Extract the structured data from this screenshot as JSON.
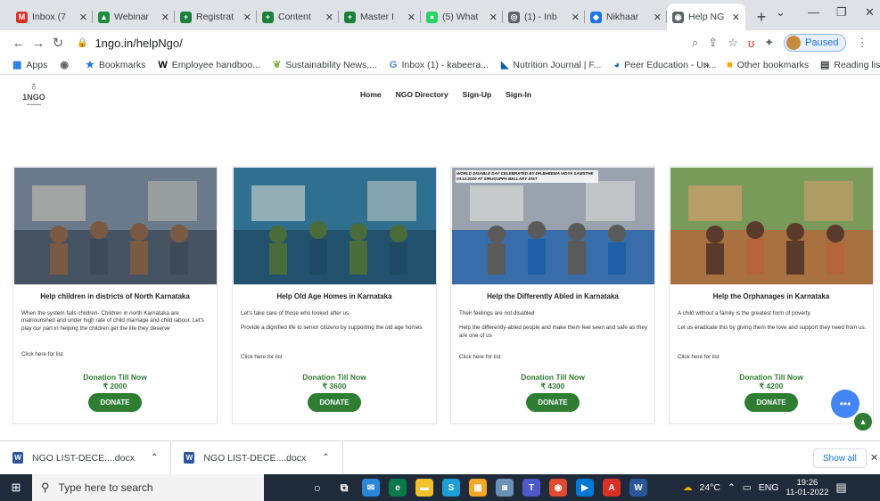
{
  "browser": {
    "tabs": [
      {
        "title": "Inbox (7",
        "icon": "gmail-icon",
        "color": "#d93025",
        "glyph": "M"
      },
      {
        "title": "Webinar",
        "icon": "drive-icon",
        "color": "#1e8e3e",
        "glyph": "▲"
      },
      {
        "title": "Registrat",
        "icon": "plus-doc-icon",
        "color": "#188038",
        "glyph": "+"
      },
      {
        "title": "Content",
        "icon": "plus-doc-icon",
        "color": "#188038",
        "glyph": "+"
      },
      {
        "title": "Master I",
        "icon": "plus-doc-icon",
        "color": "#188038",
        "glyph": "+"
      },
      {
        "title": "(5) What",
        "icon": "whatsapp-icon",
        "color": "#25d366",
        "glyph": "●"
      },
      {
        "title": "(1) - Inb",
        "icon": "mail-icon",
        "color": "#5f6368",
        "glyph": "◎"
      },
      {
        "title": "Nikhaar",
        "icon": "nikhaar-icon",
        "color": "#1a73e8",
        "glyph": "◆"
      },
      {
        "title": "Help NG",
        "icon": "globe-icon",
        "color": "#5f6368",
        "glyph": "◉",
        "active": true
      }
    ],
    "url": "1ngo.in/helpNgo/",
    "profile_status": "Paused",
    "bookmarks": [
      {
        "label": "Apps",
        "icon": "apps-grid-icon",
        "glyph": "▦",
        "color": "#1a73e8"
      },
      {
        "label": "",
        "icon": "globe-icon",
        "glyph": "◉",
        "color": "#5f6368"
      },
      {
        "label": "Bookmarks",
        "icon": "star-icon",
        "glyph": "★",
        "color": "#1a73e8"
      },
      {
        "label": "Employee handboo...",
        "icon": "wikipedia-icon",
        "glyph": "W",
        "color": "#000000"
      },
      {
        "label": "Sustainability News,...",
        "icon": "leaf-icon",
        "glyph": "❦",
        "color": "#7cb342"
      },
      {
        "label": "Inbox (1) - kabeera...",
        "icon": "google-icon",
        "glyph": "G",
        "color": "#4285f4"
      },
      {
        "label": "Nutrition Journal | F...",
        "icon": "journal-icon",
        "glyph": "◣",
        "color": "#0b5ea8"
      },
      {
        "label": "Peer Education - Un...",
        "icon": "peer-icon",
        "glyph": "◕",
        "color": "#1565c0"
      }
    ],
    "bookmarks_more": "»",
    "other_bookmarks": "Other bookmarks",
    "reading_list": "Reading list"
  },
  "site": {
    "logo_text": "1NGO",
    "nav": [
      "Home",
      "NGO Directory",
      "Sign-Up",
      "Sign-In"
    ]
  },
  "cards": [
    {
      "title": "Help children in districts of North Karnataka",
      "paragraphs": [
        "When the system fails children- Children in north Karnataka are malnourished and under high rate of child marriage and child labour. Let's play our part in helping the children get the life they deserve"
      ],
      "link": "Click here for list",
      "donation_label": "Donation Till Now",
      "amount": "₹ 2000",
      "button": "DONATE",
      "image_text": "",
      "palette": [
        "#6b7a8a",
        "#3d4a57",
        "#c7c2b5",
        "#7b5a44"
      ]
    },
    {
      "title": "Help Old Age Homes in Karnataka",
      "paragraphs": [
        "Let's take care of those who looked after us.",
        "Provide a dignified life to senior citizens by supporting the old age homes"
      ],
      "link": "Click here for list",
      "donation_label": "Donation Till Now",
      "amount": "₹ 3600",
      "button": "DONATE",
      "image_text": "",
      "palette": [
        "#2f6f8f",
        "#1e4a63",
        "#d8d8d0",
        "#4a6b3a"
      ]
    },
    {
      "title": "Help the Differently Abled in Karnataka",
      "paragraphs": [
        "Their feelings are not disabled",
        "Help the differently-abled people and make them feel seen and safe as they are one of us"
      ],
      "link": "Click here for list",
      "donation_label": "Donation Till Now",
      "amount": "₹ 4300",
      "button": "DONATE",
      "image_text": "WORLD DISABLE DAY CELEBRATED BY DR.BHEEMA VIDYA SAMSTHE 03.12.2020 AT SIRUGUPPA BELLARY DIST",
      "palette": [
        "#9aa3ad",
        "#1f5fa8",
        "#e8e6e0",
        "#5a5a5a"
      ]
    },
    {
      "title": "Help the Orphanages in Karnataka",
      "paragraphs": [
        "A child without a family is the greatest form of poverty.",
        "Let us eradicate this by giving them the love and support they need from us."
      ],
      "link": "Click here for list",
      "donation_label": "Donation Till Now",
      "amount": "₹ 4200",
      "button": "DONATE",
      "image_text": "",
      "palette": [
        "#7a9a5a",
        "#b5653a",
        "#e0a070",
        "#5a3a2a"
      ]
    }
  ],
  "downloads": [
    {
      "name": "NGO LIST-DECE....docx"
    },
    {
      "name": "NGO LIST-DECE....docx"
    }
  ],
  "downloads_show_all": "Show all",
  "taskbar": {
    "search_placeholder": "Type here to search",
    "temperature": "24°C",
    "language": "ENG",
    "time": "19:26",
    "date": "11-01-2022"
  }
}
